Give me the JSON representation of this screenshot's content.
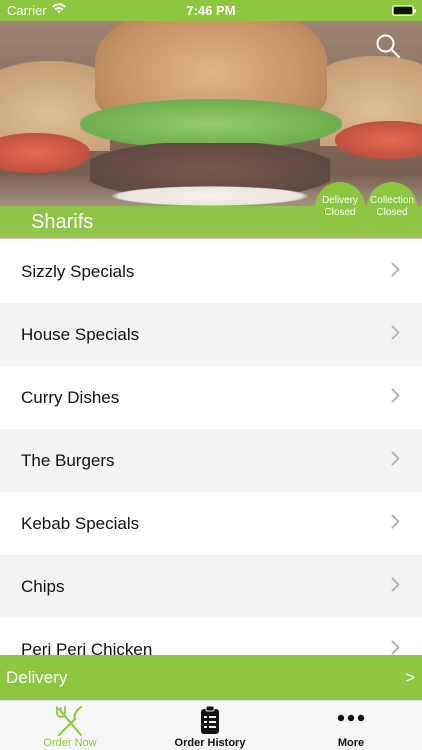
{
  "status_bar": {
    "carrier": "Carrier",
    "time": "7:46 PM"
  },
  "restaurant": {
    "name": "Sharifs",
    "delivery_status": {
      "line1": "Delivery",
      "line2": "Closed"
    },
    "collection_status": {
      "line1": "Collection",
      "line2": "Closed"
    }
  },
  "menu": {
    "items": [
      {
        "label": "Sizzly Specials"
      },
      {
        "label": "House Specials"
      },
      {
        "label": "Curry Dishes"
      },
      {
        "label": "The Burgers"
      },
      {
        "label": "Kebab Specials"
      },
      {
        "label": "Chips"
      },
      {
        "label": "Peri Peri Chicken"
      }
    ]
  },
  "delivery_bar": {
    "label": "Delivery",
    "arrow": ">"
  },
  "tabs": [
    {
      "label": "Order Now",
      "icon": "fork-knife-icon",
      "active": true
    },
    {
      "label": "Order History",
      "icon": "clipboard-list-icon",
      "active": false
    },
    {
      "label": "More",
      "icon": "more-dots-icon",
      "active": false
    }
  ],
  "colors": {
    "accent": "#8dc63f",
    "row_alt": "#f2f3f5",
    "chevron": "#b5b5b5"
  }
}
